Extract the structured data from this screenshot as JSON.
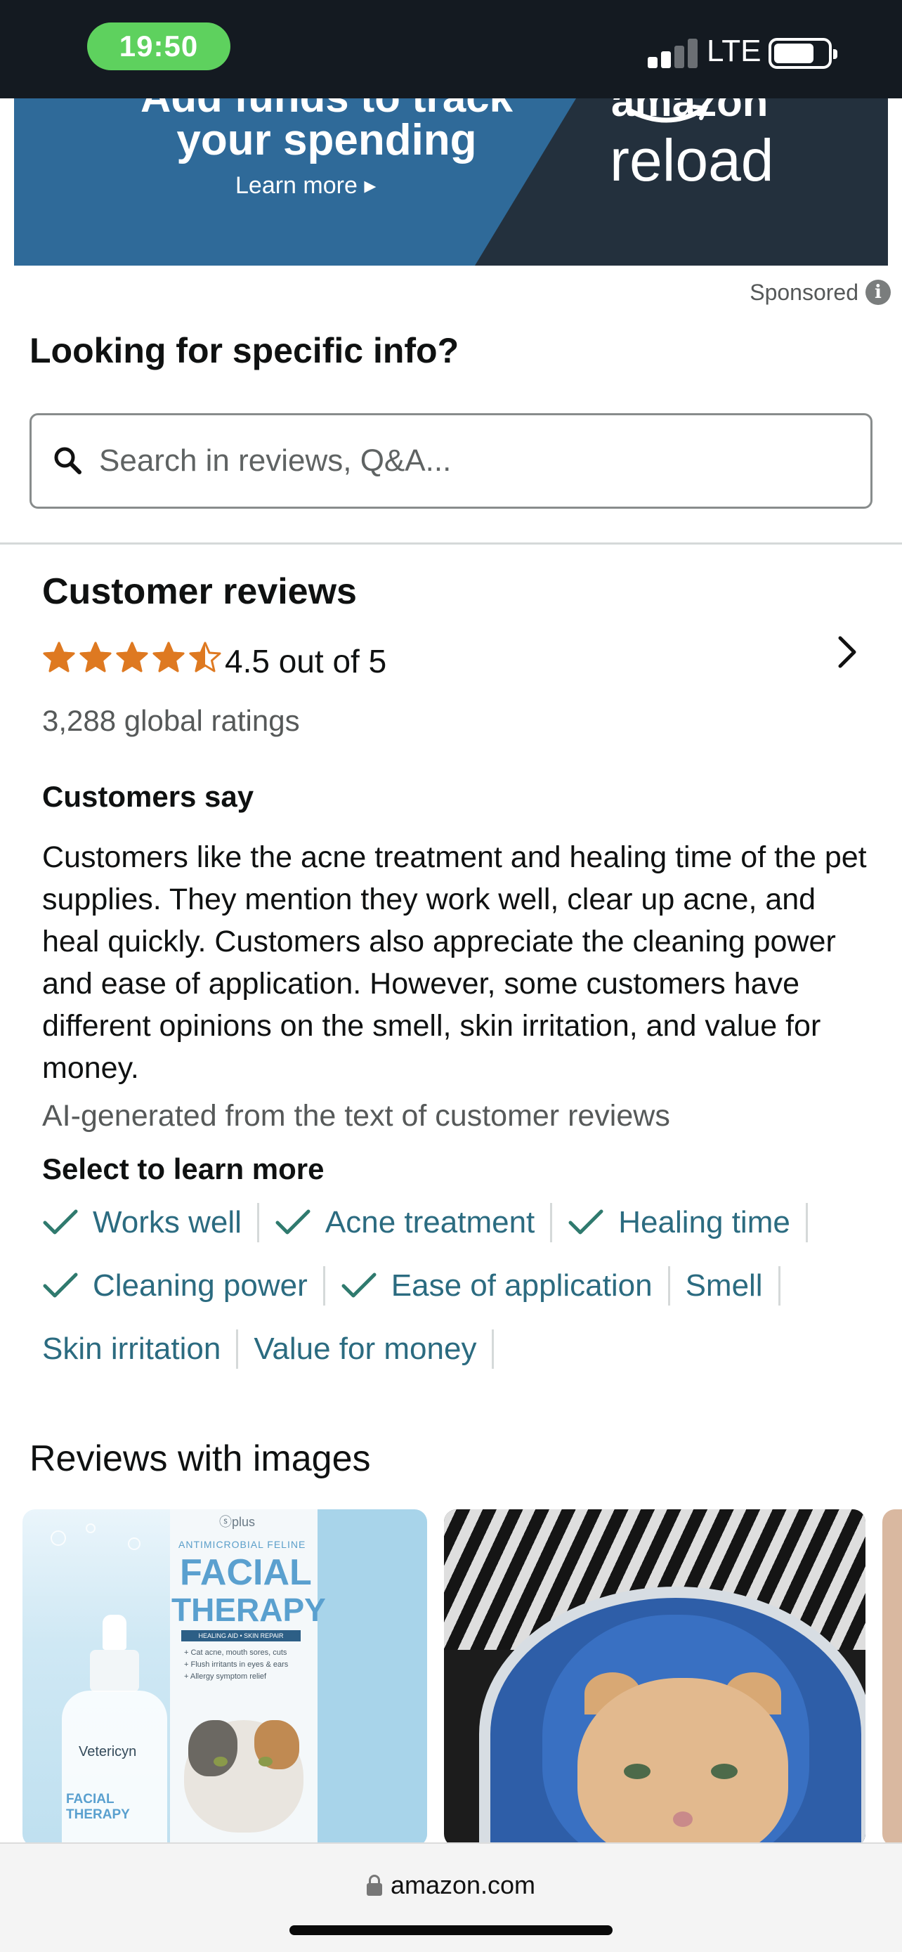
{
  "status_bar": {
    "time": "19:50",
    "network": "LTE",
    "signal_bars_filled": 2,
    "signal_bars_total": 4,
    "battery_level": 0.75,
    "colors": {
      "background": "#141a21",
      "time_pill": "#5ed15e"
    }
  },
  "ad": {
    "headline_cut": "Add funds to track",
    "headline": "your spending",
    "cta": "Learn more ▸",
    "brand_cut": "amazon",
    "brand": "reload",
    "sponsored_label": "Sponsored",
    "colors": {
      "blue": "#2f6a99",
      "dark": "#23303d"
    }
  },
  "search": {
    "title": "Looking for specific info?",
    "placeholder": "Search in reviews, Q&A..."
  },
  "reviews": {
    "title": "Customer reviews",
    "rating": 4.5,
    "rating_text": "4.5 out of 5",
    "global_ratings": "3,288 global ratings",
    "customers_say_title": "Customers say",
    "summary": "Customers like the acne treatment and healing time of the pet supplies. They mention they work well, clear up acne, and heal quickly. Customers also appreciate the cleaning power and ease of application. However, some customers have different opinions on the smell, skin irritation, and value for money.",
    "ai_note": "AI-generated from the text of customer reviews",
    "select_more": "Select to learn more",
    "tags": [
      {
        "label": "Works well",
        "positive": true
      },
      {
        "label": "Acne treatment",
        "positive": true
      },
      {
        "label": "Healing time",
        "positive": true
      },
      {
        "label": "Cleaning power",
        "positive": true
      },
      {
        "label": "Ease of application",
        "positive": true
      },
      {
        "label": "Smell",
        "positive": false
      },
      {
        "label": "Skin irritation",
        "positive": false
      },
      {
        "label": "Value for money",
        "positive": false
      }
    ],
    "colors": {
      "star": "#de7921",
      "tag_text": "#2b6b80",
      "check": "#2f7a6e"
    }
  },
  "images": {
    "title": "Reviews with images",
    "product_text": {
      "plus": "ⓢplus",
      "small": "ANTIMICROBIAL FELINE",
      "big1": "FACIAL",
      "big2": "THERAPY",
      "strip": "HEALING AID • SKIN REPAIR",
      "bullets": [
        "+ Cat acne, mouth sores, cuts",
        "+ Flush irritants in eyes & ears",
        "+ Allergy symptom relief"
      ],
      "bottle_brand": "Vetericyn",
      "bottle_label": "FACIAL THERAPY"
    }
  },
  "browser": {
    "url": "amazon.com"
  }
}
